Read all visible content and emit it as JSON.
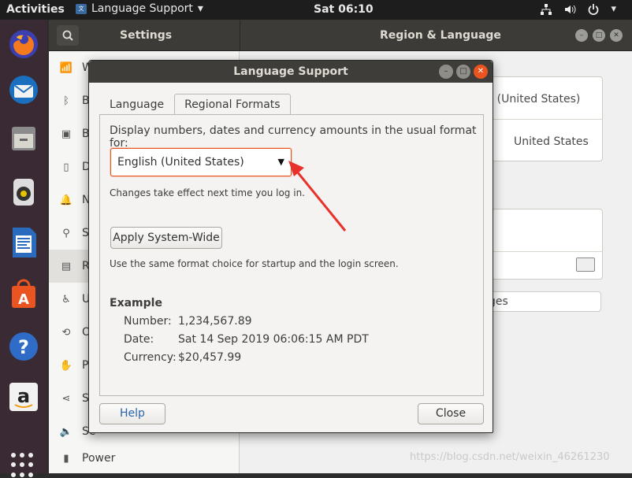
{
  "topbar": {
    "activities": "Activities",
    "app_menu": "Language Support",
    "app_menu_arrow": "▾",
    "clock": "Sat 06:10",
    "icons": [
      "network-icon",
      "volume-icon",
      "power-icon"
    ],
    "menu_arrow": "▾"
  },
  "settings": {
    "header_title": "Settings",
    "panel_title": "Region & Language",
    "sidebar_items": [
      {
        "label": "W",
        "icon": "wifi-icon"
      },
      {
        "label": "B",
        "icon": "bluetooth-icon"
      },
      {
        "label": "B",
        "icon": "background-icon"
      },
      {
        "label": "D",
        "icon": "dock-icon"
      },
      {
        "label": "N",
        "icon": "notifications-icon"
      },
      {
        "label": "Se",
        "icon": "search-icon"
      },
      {
        "label": "R",
        "icon": "region-icon"
      },
      {
        "label": "U",
        "icon": "accessibility-icon"
      },
      {
        "label": "O",
        "icon": "sharing-icon"
      },
      {
        "label": "P",
        "icon": "privacy-icon"
      },
      {
        "label": "Sh",
        "icon": "share-icon"
      },
      {
        "label": "Se",
        "icon": "sound-icon"
      },
      {
        "label": "Power",
        "icon": "power-icon"
      }
    ],
    "region_language_value": "sh (United States)",
    "region_formats_value": "United States",
    "manage_label": "ges"
  },
  "dialog": {
    "title": "Language Support",
    "tabs": [
      "Language",
      "Regional Formats"
    ],
    "active_tab": "Regional Formats",
    "prompt": "Display numbers, dates and currency amounts in the usual format for:",
    "format_value": "English (United States)",
    "note": "Changes take effect next time you log in.",
    "apply_button": "Apply System-Wide",
    "apply_note": "Use the same format choice for startup and the login screen.",
    "example_heading": "Example",
    "example": [
      {
        "label": "Number:",
        "value": "1,234,567.89"
      },
      {
        "label": "Date:",
        "value": "Sat 14 Sep 2019 06:06:15 AM PDT"
      },
      {
        "label": "Currency:",
        "value": "$20,457.99"
      }
    ],
    "help_button": "Help",
    "close_button": "Close"
  },
  "watermark": "https://blog.csdn.net/weixin_46261230",
  "colors": {
    "accent": "#e95420",
    "dock": "#3a2a33",
    "topbar": "#1d1d1d"
  }
}
